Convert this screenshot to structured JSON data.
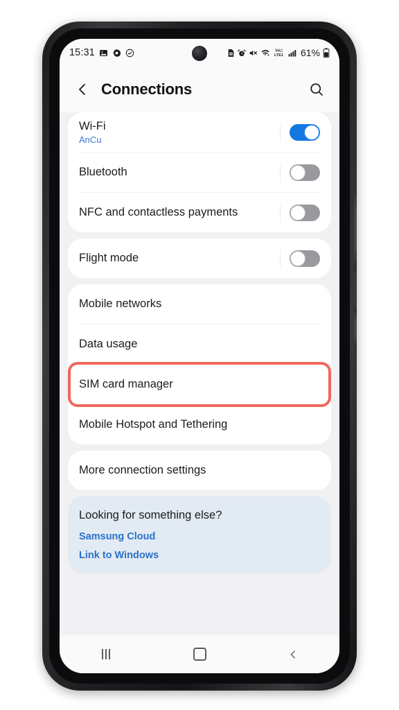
{
  "statusbar": {
    "time": "15:31",
    "left_icons": [
      "photo-icon",
      "settings-gear-icon",
      "shield-check-icon"
    ],
    "right_icons": [
      "sim-card-icon",
      "alarm-icon",
      "mute-icon",
      "wifi-icon",
      "volte-lte1-icon",
      "signal-bars-icon"
    ],
    "battery_text": "61%",
    "battery_icon": "battery-icon",
    "camera": "front-camera-punchhole"
  },
  "appbar": {
    "back_icon": "back-chevron-icon",
    "title": "Connections",
    "search_icon": "search-icon"
  },
  "sections": [
    {
      "rows": [
        {
          "title": "Wi-Fi",
          "subtitle": "AnCu",
          "toggle": "on"
        },
        {
          "title": "Bluetooth",
          "subtitle": "",
          "toggle": "off"
        },
        {
          "title": "NFC and contactless payments",
          "subtitle": "",
          "toggle": "off"
        }
      ]
    },
    {
      "rows": [
        {
          "title": "Flight mode",
          "subtitle": "",
          "toggle": "off"
        }
      ]
    },
    {
      "rows": [
        {
          "title": "Mobile networks",
          "subtitle": "",
          "toggle": "none"
        },
        {
          "title": "Data usage",
          "subtitle": "",
          "toggle": "none"
        },
        {
          "title": "SIM card manager",
          "subtitle": "",
          "toggle": "none",
          "highlighted": true
        },
        {
          "title": "Mobile Hotspot and Tethering",
          "subtitle": "",
          "toggle": "none"
        }
      ]
    },
    {
      "rows": [
        {
          "title": "More connection settings",
          "subtitle": "",
          "toggle": "none"
        }
      ]
    }
  ],
  "hint_card": {
    "title": "Looking for something else?",
    "links": [
      "Samsung Cloud",
      "Link to Windows"
    ]
  },
  "navbar": {
    "recents_icon": "recents-icon",
    "home_icon": "home-icon",
    "back_icon": "nav-back-chevron-icon"
  },
  "colors": {
    "accent_blue": "#1578e0",
    "link_blue": "#2b72c9",
    "highlight_red": "#f0685d",
    "hint_card_bg": "#e2eaf3",
    "page_bg": "#f1f1f3"
  }
}
